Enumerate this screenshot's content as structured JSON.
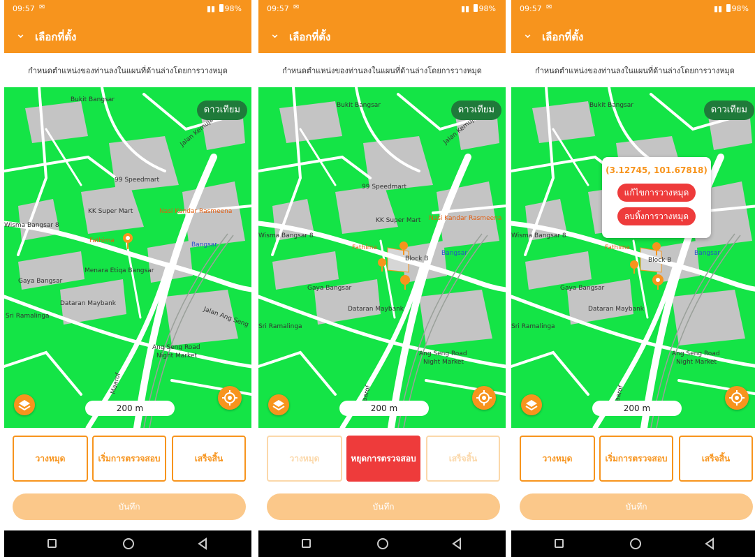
{
  "status_bar": {
    "time": "09:57",
    "battery": "98%"
  },
  "app_bar": {
    "title": "เลือกที่ตั้ง"
  },
  "instruction": "กำหนดตำแหน่งของท่านลงในแผนที่ด้านล่างโดยการวางหมุด",
  "map_controls": {
    "satellite_label": "ดาวเทียม",
    "scale_label": "200 m"
  },
  "map_labels": [
    "Bukit Bangsar",
    "99 Speedmart",
    "KK Super Mart",
    "Nasi Kandar Rasmeena",
    "Fathima",
    "Bangsar",
    "Menara Etiqa Bangsar",
    "Gaya Bangsar",
    "Dataran Maybank",
    "Sri Ramalinga",
    "Jalan Kemuja",
    "Ang Seng Road",
    "Night Market",
    "Jalan Ang Seng",
    "Wisma Bangsar 8",
    "Block B",
    "Maarof"
  ],
  "actions": {
    "place_pin": "วางหมุด",
    "start_check": "เริ่มการตรวจสอบ",
    "stop_check": "หยุดการตรวจสอบ",
    "finish": "เสร็จสิ้น",
    "save": "บันทึก"
  },
  "pin_popup": {
    "coordinates": "(3.12745, 101.67818)",
    "edit_pin": "แก้ไขการวางหมุด",
    "delete_pin": "ลบทิ้งการวางหมุด"
  },
  "colors": {
    "accent": "#f7941d",
    "danger": "#ee3b3b",
    "map_green": "#14e446",
    "satellite": "#1f7a3a"
  }
}
